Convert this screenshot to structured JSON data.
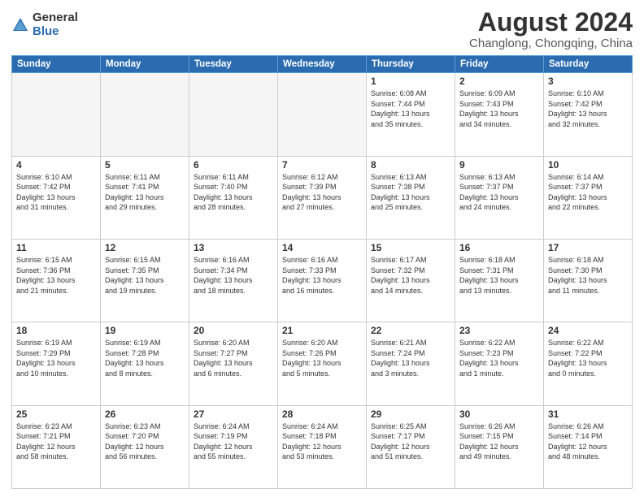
{
  "logo": {
    "general": "General",
    "blue": "Blue"
  },
  "title": "August 2024",
  "subtitle": "Changlong, Chongqing, China",
  "headers": [
    "Sunday",
    "Monday",
    "Tuesday",
    "Wednesday",
    "Thursday",
    "Friday",
    "Saturday"
  ],
  "weeks": [
    [
      {
        "day": "",
        "info": ""
      },
      {
        "day": "",
        "info": ""
      },
      {
        "day": "",
        "info": ""
      },
      {
        "day": "",
        "info": ""
      },
      {
        "day": "1",
        "info": "Sunrise: 6:08 AM\nSunset: 7:44 PM\nDaylight: 13 hours\nand 35 minutes."
      },
      {
        "day": "2",
        "info": "Sunrise: 6:09 AM\nSunset: 7:43 PM\nDaylight: 13 hours\nand 34 minutes."
      },
      {
        "day": "3",
        "info": "Sunrise: 6:10 AM\nSunset: 7:42 PM\nDaylight: 13 hours\nand 32 minutes."
      }
    ],
    [
      {
        "day": "4",
        "info": "Sunrise: 6:10 AM\nSunset: 7:42 PM\nDaylight: 13 hours\nand 31 minutes."
      },
      {
        "day": "5",
        "info": "Sunrise: 6:11 AM\nSunset: 7:41 PM\nDaylight: 13 hours\nand 29 minutes."
      },
      {
        "day": "6",
        "info": "Sunrise: 6:11 AM\nSunset: 7:40 PM\nDaylight: 13 hours\nand 28 minutes."
      },
      {
        "day": "7",
        "info": "Sunrise: 6:12 AM\nSunset: 7:39 PM\nDaylight: 13 hours\nand 27 minutes."
      },
      {
        "day": "8",
        "info": "Sunrise: 6:13 AM\nSunset: 7:38 PM\nDaylight: 13 hours\nand 25 minutes."
      },
      {
        "day": "9",
        "info": "Sunrise: 6:13 AM\nSunset: 7:37 PM\nDaylight: 13 hours\nand 24 minutes."
      },
      {
        "day": "10",
        "info": "Sunrise: 6:14 AM\nSunset: 7:37 PM\nDaylight: 13 hours\nand 22 minutes."
      }
    ],
    [
      {
        "day": "11",
        "info": "Sunrise: 6:15 AM\nSunset: 7:36 PM\nDaylight: 13 hours\nand 21 minutes."
      },
      {
        "day": "12",
        "info": "Sunrise: 6:15 AM\nSunset: 7:35 PM\nDaylight: 13 hours\nand 19 minutes."
      },
      {
        "day": "13",
        "info": "Sunrise: 6:16 AM\nSunset: 7:34 PM\nDaylight: 13 hours\nand 18 minutes."
      },
      {
        "day": "14",
        "info": "Sunrise: 6:16 AM\nSunset: 7:33 PM\nDaylight: 13 hours\nand 16 minutes."
      },
      {
        "day": "15",
        "info": "Sunrise: 6:17 AM\nSunset: 7:32 PM\nDaylight: 13 hours\nand 14 minutes."
      },
      {
        "day": "16",
        "info": "Sunrise: 6:18 AM\nSunset: 7:31 PM\nDaylight: 13 hours\nand 13 minutes."
      },
      {
        "day": "17",
        "info": "Sunrise: 6:18 AM\nSunset: 7:30 PM\nDaylight: 13 hours\nand 11 minutes."
      }
    ],
    [
      {
        "day": "18",
        "info": "Sunrise: 6:19 AM\nSunset: 7:29 PM\nDaylight: 13 hours\nand 10 minutes."
      },
      {
        "day": "19",
        "info": "Sunrise: 6:19 AM\nSunset: 7:28 PM\nDaylight: 13 hours\nand 8 minutes."
      },
      {
        "day": "20",
        "info": "Sunrise: 6:20 AM\nSunset: 7:27 PM\nDaylight: 13 hours\nand 6 minutes."
      },
      {
        "day": "21",
        "info": "Sunrise: 6:20 AM\nSunset: 7:26 PM\nDaylight: 13 hours\nand 5 minutes."
      },
      {
        "day": "22",
        "info": "Sunrise: 6:21 AM\nSunset: 7:24 PM\nDaylight: 13 hours\nand 3 minutes."
      },
      {
        "day": "23",
        "info": "Sunrise: 6:22 AM\nSunset: 7:23 PM\nDaylight: 13 hours\nand 1 minute."
      },
      {
        "day": "24",
        "info": "Sunrise: 6:22 AM\nSunset: 7:22 PM\nDaylight: 13 hours\nand 0 minutes."
      }
    ],
    [
      {
        "day": "25",
        "info": "Sunrise: 6:23 AM\nSunset: 7:21 PM\nDaylight: 12 hours\nand 58 minutes."
      },
      {
        "day": "26",
        "info": "Sunrise: 6:23 AM\nSunset: 7:20 PM\nDaylight: 12 hours\nand 56 minutes."
      },
      {
        "day": "27",
        "info": "Sunrise: 6:24 AM\nSunset: 7:19 PM\nDaylight: 12 hours\nand 55 minutes."
      },
      {
        "day": "28",
        "info": "Sunrise: 6:24 AM\nSunset: 7:18 PM\nDaylight: 12 hours\nand 53 minutes."
      },
      {
        "day": "29",
        "info": "Sunrise: 6:25 AM\nSunset: 7:17 PM\nDaylight: 12 hours\nand 51 minutes."
      },
      {
        "day": "30",
        "info": "Sunrise: 6:26 AM\nSunset: 7:15 PM\nDaylight: 12 hours\nand 49 minutes."
      },
      {
        "day": "31",
        "info": "Sunrise: 6:26 AM\nSunset: 7:14 PM\nDaylight: 12 hours\nand 48 minutes."
      }
    ]
  ]
}
